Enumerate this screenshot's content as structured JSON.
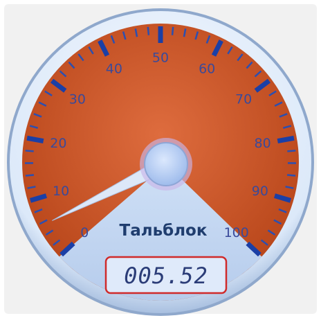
{
  "gauge": {
    "title": "Тальблок",
    "min": 0,
    "max": 100,
    "value": 5.52,
    "readout": "005.52",
    "major_ticks": [
      0,
      10,
      20,
      30,
      40,
      50,
      60,
      70,
      80,
      90,
      100
    ],
    "minor_divisions": 5
  },
  "colors": {
    "dial_face": "#c24f22",
    "dial_face_light": "#d9663a",
    "bezel": "#dbe8f8",
    "bezel_edge": "#9cb3d4",
    "tick_major": "#1b3fa6",
    "tick_minor": "#2c4fb0",
    "hub": "#b9d0f5",
    "hub_ring": "#8e7fc0",
    "needle": "#dbe6f7",
    "readout_border": "#d02a2a",
    "label_color": "#3a4a9a"
  }
}
